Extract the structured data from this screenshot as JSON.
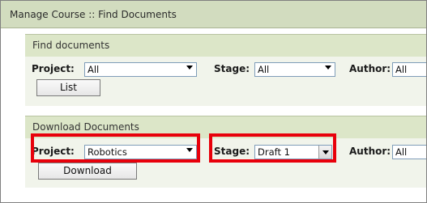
{
  "window": {
    "title": "Manage Course :: Find Documents"
  },
  "find_panel": {
    "header": "Find documents",
    "project_label": "Project:",
    "project_value": "All",
    "stage_label": "Stage:",
    "stage_value": "All",
    "author_label": "Author:",
    "author_value": "All",
    "list_button": "List"
  },
  "download_panel": {
    "header": "Download Documents",
    "project_label": "Project:",
    "project_value": "Robotics",
    "stage_label": "Stage:",
    "stage_value": "Draft 1",
    "author_label": "Author:",
    "author_value": "All",
    "download_button": "Download"
  },
  "highlight_color": "#e8000b"
}
